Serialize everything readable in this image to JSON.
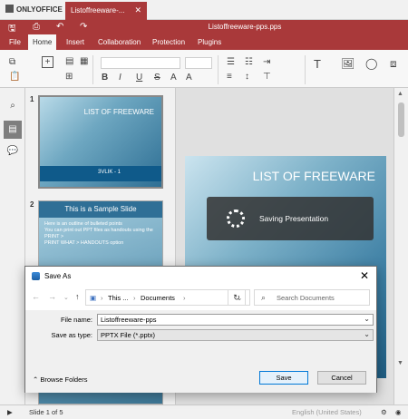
{
  "app": {
    "logo": "ONLYOFFICE",
    "tab_title": "Listoffreeware-...",
    "tab_close": "✕",
    "doc_title": "Listoffreeware-pps.pps"
  },
  "menu": [
    "File",
    "Home",
    "Insert",
    "Collaboration",
    "Protection",
    "Plugins"
  ],
  "thumbnails": {
    "slide1_num": "1",
    "slide1_title": "LIST OF FREEWARE",
    "slide1_footer": "3VLIK - 1",
    "slide2_num": "2",
    "slide2_title": "This is a Sample Slide",
    "slide2_bullets": [
      "Here is an outline of bulleted points",
      "You can print out PPT files as handouts using the",
      "PRINT >",
      "PRINT WHAT > HANDOUTS option"
    ]
  },
  "main_slide": {
    "title": "LIST OF FREEWARE"
  },
  "saving_overlay": {
    "text": "Saving Presentation"
  },
  "dialog": {
    "title": "Save As",
    "breadcrumb": [
      "This ...",
      "Documents"
    ],
    "search_placeholder": "Search Documents",
    "file_name_label": "File name:",
    "file_name_value": "Listoffreeware-pps",
    "save_type_label": "Save as type:",
    "save_type_value": "PPTX File (*.pptx)",
    "browse_folders": "Browse Folders",
    "save_label": "Save",
    "cancel_label": "Cancel"
  },
  "status": {
    "slide_counter": "Slide 1 of 5",
    "language": "English (United States)"
  },
  "colors": {
    "accent": "#a9393a"
  }
}
